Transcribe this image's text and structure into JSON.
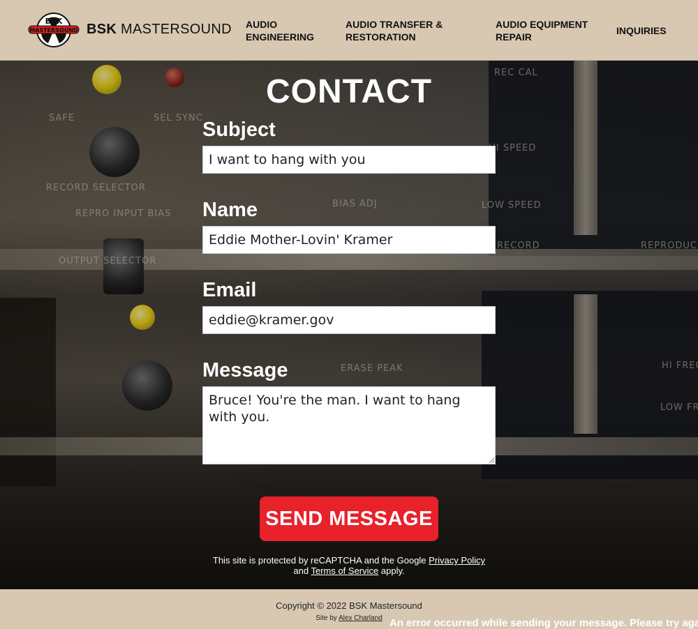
{
  "brand": {
    "logo_text_top": "BSK",
    "logo_text_band": "MASTERSOUND",
    "name_bold": "BSK",
    "name_rest": "MASTERSOUND"
  },
  "nav": [
    {
      "line1": "AUDIO",
      "line2": "ENGINEERING"
    },
    {
      "line1": "AUDIO TRANSFER &",
      "line2": "RESTORATION"
    },
    {
      "line1": "AUDIO EQUIPMENT",
      "line2": "REPAIR"
    },
    {
      "line1": "INQUIRIES",
      "line2": ""
    }
  ],
  "page_title": "CONTACT",
  "form": {
    "subject": {
      "label": "Subject",
      "value": "I want to hang with you"
    },
    "name": {
      "label": "Name",
      "value": "Eddie Mother-Lovin' Kramer"
    },
    "email": {
      "label": "Email",
      "value": "eddie@kramer.gov"
    },
    "message": {
      "label": "Message",
      "value": "Bruce! You're the man. I want to hang with you."
    },
    "submit_label": "SEND MESSAGE"
  },
  "recaptcha": {
    "prefix": "This site is protected by reCAPTCHA and the Google",
    "privacy_link": "Privacy Policy",
    "and": "and",
    "terms_link": "Terms of Service",
    "suffix": "apply."
  },
  "background_plates": [
    "SAFE",
    "SEL SYNC",
    "RECORD SELECTOR",
    "REPRO INPUT BIAS",
    "OUTPUT SELECTOR",
    "REC CAL",
    "HI SPEED",
    "LOW SPEED",
    "RECORD",
    "REPRODUCE",
    "BIAS ADJ",
    "ERASE PEAK",
    "HI FREQ",
    "LOW FREQ"
  ],
  "footer": {
    "copyright": "Copyright © 2022 BSK Mastersound",
    "site_by": "Site by",
    "author_link": "Alex Charland"
  },
  "error_message": "An error occurred while sending your message. Please try again.",
  "colors": {
    "header_bg": "#d8c8b2",
    "accent_red": "#e8212a",
    "text_white": "#ffffff"
  }
}
